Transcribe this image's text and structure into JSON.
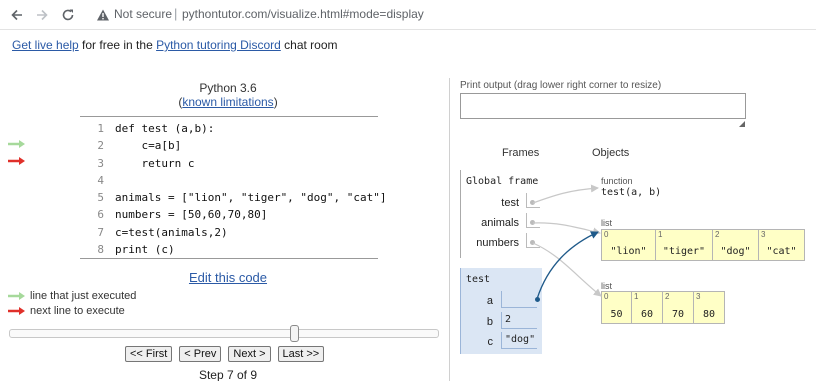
{
  "browser": {
    "security_label": "Not secure",
    "url": "pythontutor.com/visualize.html#mode=display"
  },
  "help": {
    "link1": "Get live help",
    "text1": " for free in the ",
    "link2": "Python tutoring Discord",
    "text2": " chat room"
  },
  "code_panel": {
    "language": "Python 3.6",
    "paren_open": "(",
    "limitations_link": "known limitations",
    "paren_close": ")",
    "lines": [
      {
        "num": "1",
        "code": "def test (a,b):"
      },
      {
        "num": "2",
        "code": "    c=a[b]"
      },
      {
        "num": "3",
        "code": "    return c"
      },
      {
        "num": "4",
        "code": ""
      },
      {
        "num": "5",
        "code": "animals = [\"lion\", \"tiger\", \"dog\", \"cat\"]"
      },
      {
        "num": "6",
        "code": "numbers = [50,60,70,80]"
      },
      {
        "num": "7",
        "code": "c=test(animals,2)"
      },
      {
        "num": "8",
        "code": "print (c)"
      }
    ],
    "edit_link": "Edit this code"
  },
  "legend": {
    "executed": "line that just executed",
    "next": "next line to execute",
    "executed_color": "#a6d99b",
    "next_color": "#e0302a"
  },
  "navigation": {
    "first": "<< First",
    "prev": "< Prev",
    "next": "Next >",
    "last": "Last >>",
    "step_text": "Step 7 of 9",
    "current_step": 7,
    "total_steps": 9
  },
  "output": {
    "label": "Print output (drag lower right corner to resize)",
    "content": ""
  },
  "viz": {
    "frames_header": "Frames",
    "objects_header": "Objects",
    "global_frame": {
      "title": "Global frame",
      "vars": [
        "test",
        "animals",
        "numbers"
      ]
    },
    "active_frame": {
      "title": "test",
      "vars": [
        {
          "name": "a",
          "value": ""
        },
        {
          "name": "b",
          "value": "2"
        },
        {
          "name": "c",
          "value": "\"dog\""
        }
      ]
    },
    "function_obj": {
      "type": "function",
      "signature": "test(a, b)"
    },
    "list_animals": {
      "type": "list",
      "items": [
        {
          "index": "0",
          "value": "\"lion\""
        },
        {
          "index": "1",
          "value": "\"tiger\""
        },
        {
          "index": "2",
          "value": "\"dog\""
        },
        {
          "index": "3",
          "value": "\"cat\""
        }
      ]
    },
    "list_numbers": {
      "type": "list",
      "items": [
        {
          "index": "0",
          "value": "50"
        },
        {
          "index": "1",
          "value": "60"
        },
        {
          "index": "2",
          "value": "70"
        },
        {
          "index": "3",
          "value": "80"
        }
      ]
    },
    "pointer_color": "#1f5a8a",
    "object_fill": "#ffffc6"
  }
}
